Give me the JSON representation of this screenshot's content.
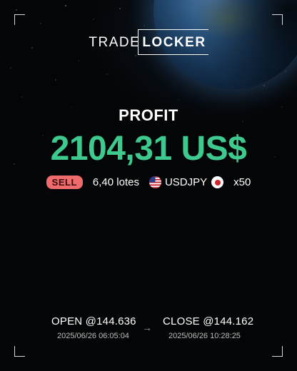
{
  "logo": {
    "part1": "TRADE",
    "part2": "LOCKER"
  },
  "profit": {
    "label": "PROFIT",
    "value": "2104,31 US$",
    "color": "#3ec98e"
  },
  "trade": {
    "side": "SELL",
    "side_color": "#f06b6b",
    "lots": "6,40 lotes",
    "base_flag_icon": "us-flag-icon",
    "symbol": "USDJPY",
    "quote_flag_icon": "jp-flag-icon",
    "leverage": "x50"
  },
  "open": {
    "title": "OPEN @144.636",
    "date": "2025/06/26 06:05:04"
  },
  "close": {
    "title": "CLOSE @144.162",
    "date": "2025/06/26 10:28:25"
  },
  "arrow_icon": "arrow-right-icon"
}
